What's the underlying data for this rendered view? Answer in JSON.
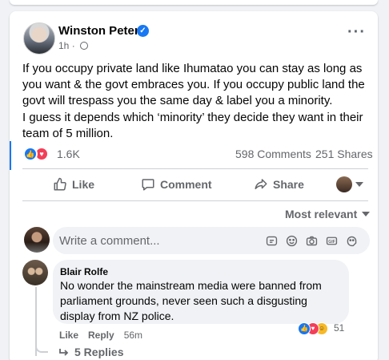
{
  "post": {
    "author": "Winston Peters",
    "time": "1h",
    "paragraph1": "If you occupy private land like Ihumatao you can stay as long as you want & the govt embraces you. If you occupy public land the govt will trespass you the same day & label you a minority.",
    "paragraph2": "I guess it depends which ‘minority’ they decide they want in their team of 5 million.",
    "reaction_count": "1.6K",
    "comments_count": "598 Comments",
    "shares_count": "251 Shares"
  },
  "actions": {
    "like": "Like",
    "comment": "Comment",
    "share": "Share"
  },
  "sort": {
    "label": "Most relevant"
  },
  "composer": {
    "placeholder": "Write a comment..."
  },
  "comment": {
    "author": "Blair Rolfe",
    "text": "No wonder the mainstream media were banned from parliament grounds, never seen such a disgusting display from NZ police.",
    "like": "Like",
    "reply": "Reply",
    "time": "56m",
    "reaction_count": "51",
    "replies": "5 Replies"
  },
  "colors": {
    "accent": "#1877f2",
    "love": "#f33e58",
    "haha": "#f7b928",
    "muted_text": "#65676b"
  },
  "icons": [
    "verified-badge-icon",
    "globe-icon",
    "more-options-icon",
    "like-icon",
    "comment-icon",
    "share-icon",
    "chevron-down-icon",
    "sticker-icon",
    "emoji-icon",
    "camera-icon",
    "gif-icon",
    "avatar-sticker-icon",
    "reply-arrow-icon"
  ]
}
